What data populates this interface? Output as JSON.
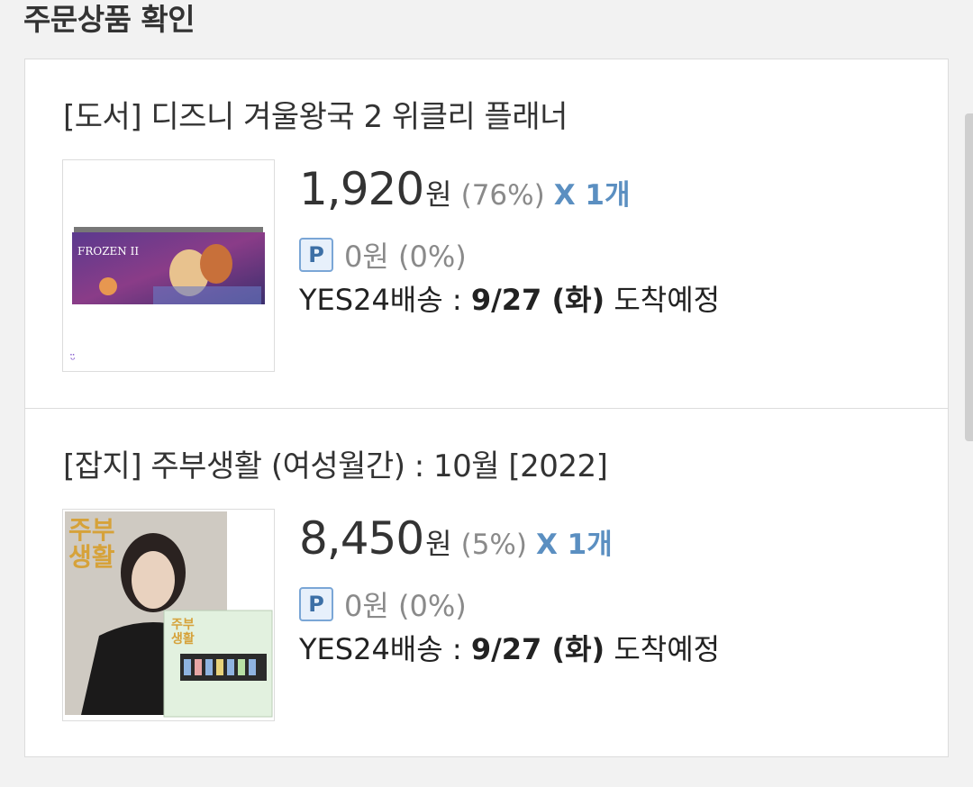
{
  "section": {
    "title": "주문상품 확인"
  },
  "items": [
    {
      "name": "[도서] 디즈니 겨울왕국 2 위클리 플래너",
      "price": "1,920",
      "currency": "원",
      "discount": "(76%)",
      "quantity": "X 1개",
      "points": "0원 (0%)",
      "point_badge": "P",
      "shipping_prefix": "YES24배송 : ",
      "shipping_date": "9/27 (화)",
      "shipping_suffix": " 도착예정",
      "thumb_logo": "FROZEN II"
    },
    {
      "name": "[잡지] 주부생활 (여성월간) : 10월 [2022]",
      "price": "8,450",
      "currency": "원",
      "discount": "(5%)",
      "quantity": "X 1개",
      "points": "0원 (0%)",
      "point_badge": "P",
      "shipping_prefix": "YES24배송 : ",
      "shipping_date": "9/27 (화)",
      "shipping_suffix": " 도착예정",
      "thumb_logo": "주부\n생활"
    }
  ]
}
